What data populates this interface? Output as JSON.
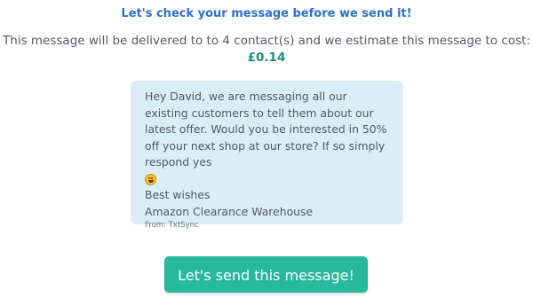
{
  "header": {
    "title": "Let's check your message before we send it!",
    "delivery_text": "This message will be delivered to to 4 contact(s) and we estimate this message to cost:",
    "cost": "£0.14"
  },
  "message": {
    "body": "Hey David, we are messaging all our existing customers to tell them about our latest offer. Would you be interested in 50% off your next shop at our store? If so simply respond yes",
    "emoji": "grinning-face-icon",
    "signoff": "Best wishes",
    "sender_name": "Amazon Clearance Warehouse",
    "from": "From: TxtSync"
  },
  "actions": {
    "send_label": "Let's send this message!"
  },
  "colors": {
    "heading": "#2f6fd1",
    "cost": "#1a8f83",
    "message_bg": "#d9eef7",
    "button_bg": "#27b99c"
  }
}
